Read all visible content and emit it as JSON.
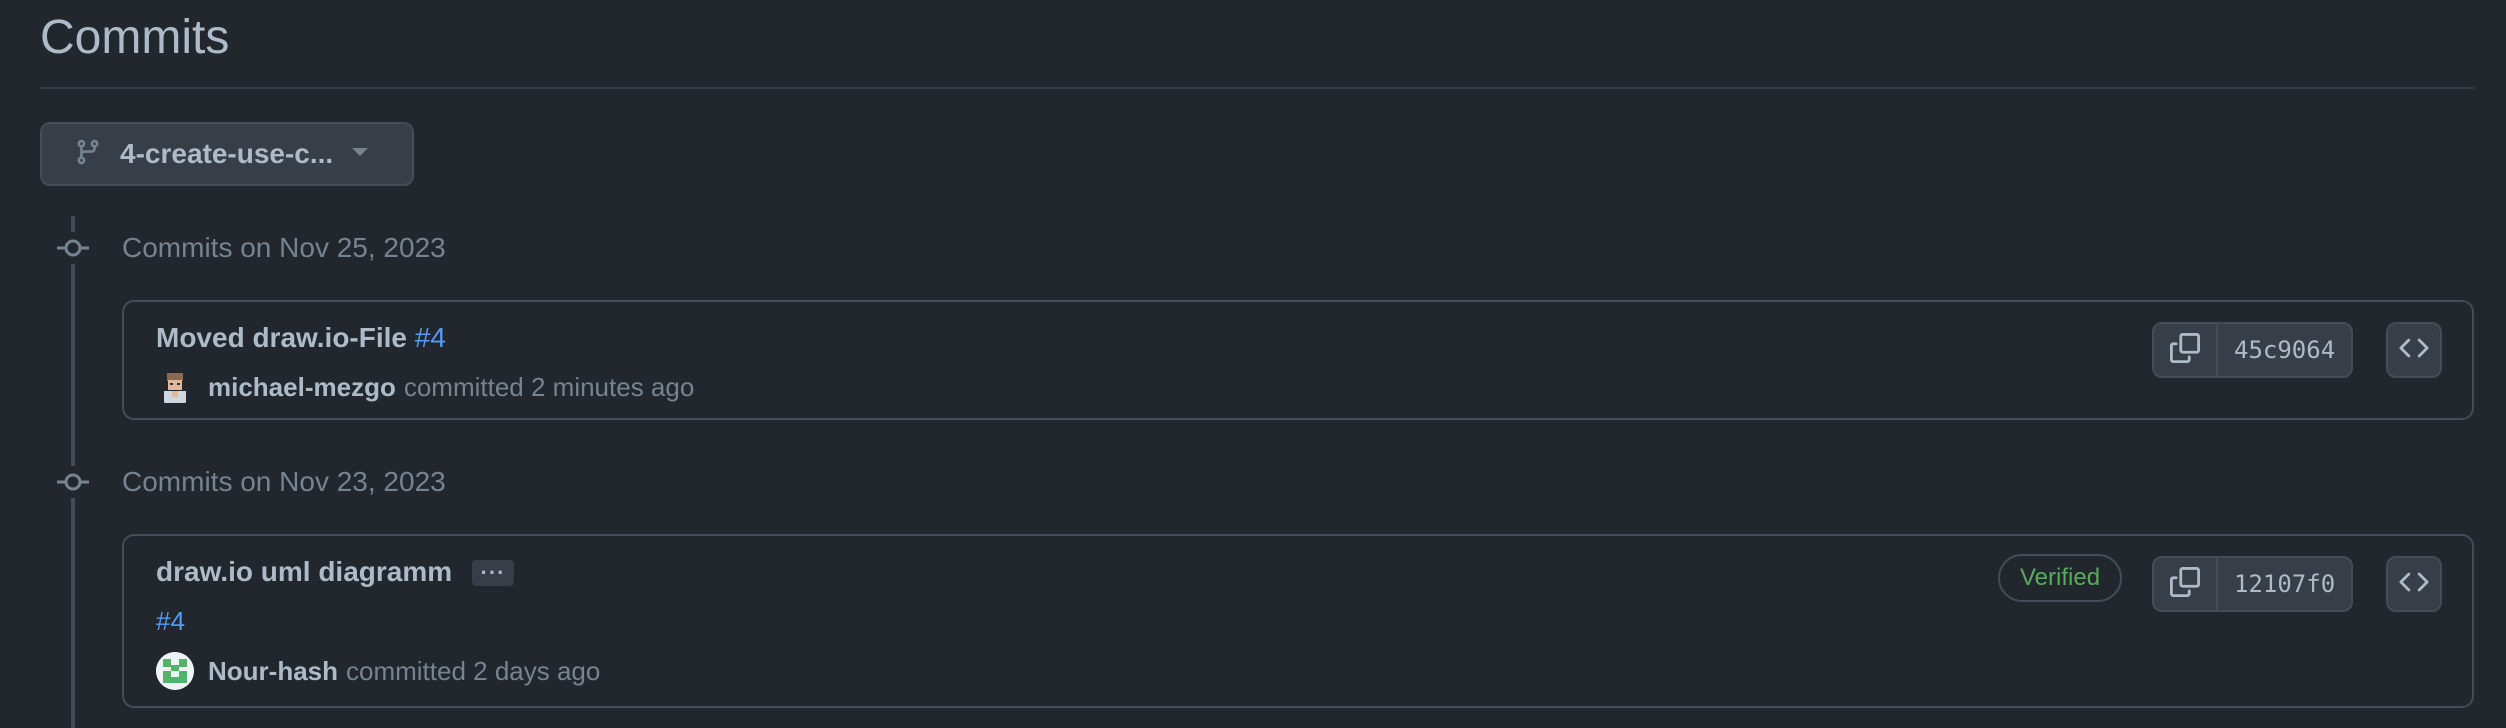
{
  "page": {
    "title": "Commits"
  },
  "branch": {
    "label": "4-create-use-c..."
  },
  "groups": [
    {
      "heading": "Commits on Nov 25, 2023",
      "commits": [
        {
          "title": "Moved draw.io-File",
          "pr_ref": "#4",
          "author": "michael-mezgo",
          "committed_text": "committed 2 minutes ago",
          "sha": "45c9064",
          "verified": ""
        }
      ]
    },
    {
      "heading": "Commits on Nov 23, 2023",
      "commits": [
        {
          "title": "draw.io uml diagramm",
          "ellipsis": "···",
          "pr_ref": "#4",
          "author": "Nour-hash",
          "committed_text": "committed 2 days ago",
          "sha": "12107f0",
          "verified": "Verified"
        }
      ]
    }
  ],
  "colors": {
    "background": "#22272e",
    "border": "#444c56",
    "link": "#539bf5",
    "verified": "#57ab5a",
    "muted_text": "#768390"
  }
}
